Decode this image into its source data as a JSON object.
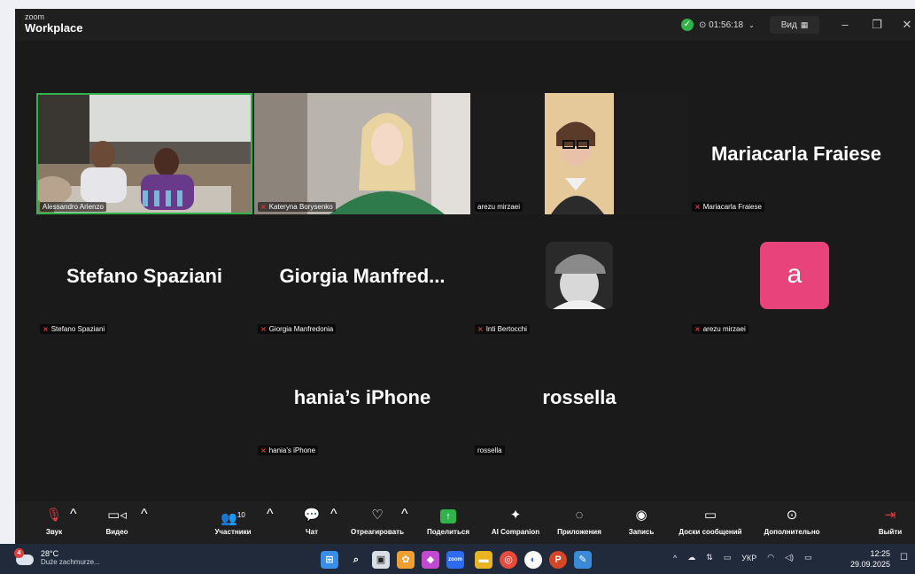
{
  "titlebar": {
    "brand_small": "zoom",
    "brand_big": "Workplace",
    "timer": "⊙ 01:56:18",
    "view_label": "Вид"
  },
  "tiles": [
    {
      "name": "Alessandro Arienzo",
      "muted": false,
      "video": true
    },
    {
      "name": "Kateryna Borysenko",
      "muted": true,
      "video": true
    },
    {
      "name": "arezu mirzaei",
      "muted": false,
      "video": true
    },
    {
      "name": "Mariacarla Fraiese",
      "display": "Mariacarla Fraiese",
      "muted": true,
      "video": false
    },
    {
      "name": "Stefano Spaziani",
      "display": "Stefano Spaziani",
      "muted": true,
      "video": false
    },
    {
      "name": "Giorgia Manfredonia",
      "display": "Giorgia  Manfred...",
      "muted": true,
      "video": false
    },
    {
      "name": "Inti Bertocchi",
      "muted": true,
      "video": false
    },
    {
      "name": "arezu mirzaei",
      "avatar_letter": "a",
      "muted": true,
      "video": false
    },
    {
      "name": "hania’s iPhone",
      "display": "hania’s iPhone",
      "muted": true,
      "video": false
    },
    {
      "name": "rossella",
      "display": "rossella",
      "muted": false,
      "video": false
    }
  ],
  "toolbar": {
    "audio": "Звук",
    "video": "Видео",
    "participants": "Участники",
    "participants_count": "10",
    "chat": "Чат",
    "react": "Отреагировать",
    "share": "Поделиться",
    "ai": "AI Companion",
    "apps": "Приложения",
    "record": "Запись",
    "whiteboards": "Доски сообщений",
    "more": "Дополнительно",
    "leave": "Выйти"
  },
  "taskbar": {
    "weather_temp": "28°C",
    "weather_desc": "Duże zachmurze...",
    "weather_badge": "4",
    "lang": "УКР",
    "time": "12:25",
    "date": "29.09.2025"
  },
  "colors": {
    "accent_green": "#2fb34a",
    "mute_red": "#e23b3b",
    "avatar_pink": "#e8437a"
  }
}
